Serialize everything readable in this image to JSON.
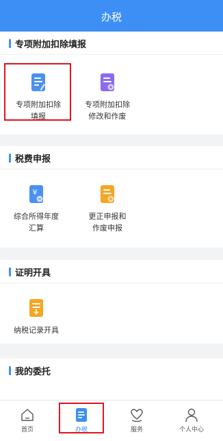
{
  "header": {
    "title": "办税"
  },
  "sections": {
    "special_deduction": {
      "title": "专项附加扣除填报",
      "items": [
        {
          "line1": "专项附加扣除",
          "line2": "填报",
          "icon": "edit-document-icon",
          "color": "#4a90f0"
        },
        {
          "line1": "专项附加扣除",
          "line2": "修改和作废",
          "icon": "document-settings-icon",
          "color": "#8b6cf0"
        }
      ]
    },
    "tax_filing": {
      "title": "税费申报",
      "items": [
        {
          "line1": "综合所得年度",
          "line2": "汇算",
          "icon": "yuan-document-icon",
          "color": "#4a90f0"
        },
        {
          "line1": "更正申报和",
          "line2": "作废申报",
          "icon": "document-cancel-icon",
          "color": "#f5a623"
        }
      ]
    },
    "certificate": {
      "title": "证明开具",
      "items": [
        {
          "line1": "纳税记录开具",
          "line2": "",
          "icon": "download-document-icon",
          "color": "#f5a623"
        }
      ]
    },
    "delegation": {
      "title": "我的委托"
    }
  },
  "tabbar": {
    "items": [
      {
        "label": "首页",
        "icon": "home-icon"
      },
      {
        "label": "办税",
        "icon": "tax-document-icon"
      },
      {
        "label": "服务",
        "icon": "heart-hand-icon"
      },
      {
        "label": "个人中心",
        "icon": "person-icon"
      }
    ],
    "active": "办税"
  },
  "colors": {
    "primary": "#3d8ff5",
    "highlight": "#e0141c",
    "background": "#f2f3f5"
  }
}
